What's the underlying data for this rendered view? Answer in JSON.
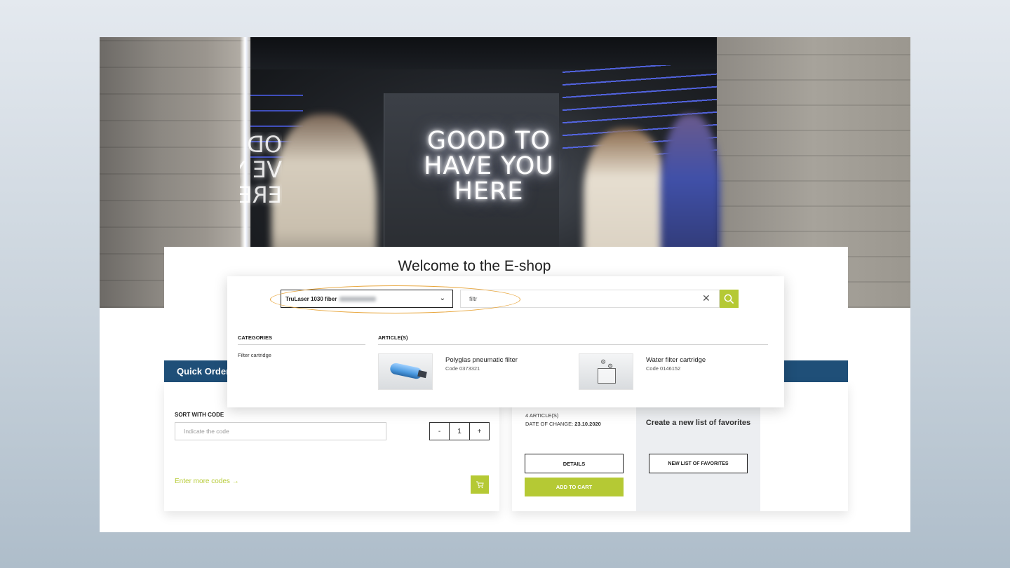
{
  "hero": {
    "neon_lines": [
      "GOOD TO",
      "HAVE YOU",
      "HERE"
    ],
    "neon_reflection": [
      "OD",
      "VE Y",
      "ERE"
    ]
  },
  "welcome": {
    "title": "Welcome to the E-shop"
  },
  "search": {
    "machine_label": "TruLaser 1030 fiber",
    "query": "filtr",
    "clear_icon": "close-icon",
    "search_icon": "search-icon",
    "highlight_color": "#e8a53a",
    "categories_heading": "CATEGORIES",
    "categories": [
      "Filter cartridge"
    ],
    "articles_heading": "ARTICLE(S)",
    "articles": [
      {
        "name": "Polyglas pneumatic filter",
        "code": "Code 0373321"
      },
      {
        "name": "Water filter cartridge",
        "code": "Code 0146152"
      }
    ]
  },
  "quick_order": {
    "title": "Quick Order",
    "sort_label": "SORT WITH CODE",
    "code_placeholder": "Indicate the code",
    "qty_minus": "-",
    "qty_value": "1",
    "qty_plus": "+",
    "enter_more": "Enter more codes →",
    "cart_icon": "cart-icon"
  },
  "favorites": {
    "count": "4 ARTICLE(S)",
    "date_label": "DATE OF CHANGE:",
    "date_value": "23.10.2020",
    "details_label": "DETAILS",
    "add_to_cart_label": "ADD TO CART",
    "new_list_text": "Create a new list of favorites",
    "new_list_button": "NEW LIST OF FAVORITES"
  },
  "colors": {
    "header_blue": "#1f4f78",
    "accent_green": "#b5c934"
  }
}
